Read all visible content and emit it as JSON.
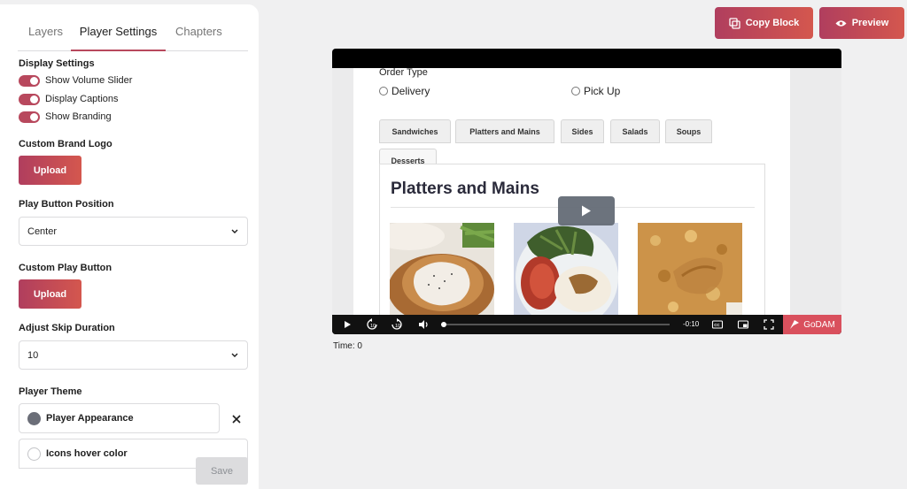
{
  "tabs": {
    "layers": "Layers",
    "player_settings": "Player Settings",
    "chapters": "Chapters"
  },
  "display_settings": {
    "title": "Display Settings",
    "toggles": [
      {
        "label": "Show Volume Slider",
        "on": true
      },
      {
        "label": "Display Captions",
        "on": true
      },
      {
        "label": "Show Branding",
        "on": true
      }
    ]
  },
  "brand_logo": {
    "title": "Custom Brand Logo",
    "button": "Upload"
  },
  "play_button_position": {
    "title": "Play Button Position",
    "value": "Center"
  },
  "custom_play_button": {
    "title": "Custom Play Button",
    "button": "Upload"
  },
  "skip_duration": {
    "title": "Adjust Skip Duration",
    "value": "10"
  },
  "player_theme": {
    "title": "Player Theme",
    "appearance_label": "Player Appearance",
    "appearance_color": "#6b6e78",
    "hover_label": "Icons hover color",
    "save": "Save"
  },
  "header_buttons": {
    "copy": "Copy Block",
    "preview": "Preview"
  },
  "video": {
    "order_type": "Order Type",
    "options": [
      "Delivery",
      "Pick Up"
    ],
    "food_tabs": [
      "Sandwiches",
      "Platters and Mains",
      "Sides",
      "Salads",
      "Soups",
      "Desserts"
    ],
    "heading": "Platters and Mains",
    "time_remaining": "-0:10",
    "brand": "GoDAM"
  },
  "time_readout": "Time: 0",
  "colors": {
    "accent": "#b8485d",
    "accent_gradient_end": "#d4574e",
    "brand": "#d9505d"
  }
}
